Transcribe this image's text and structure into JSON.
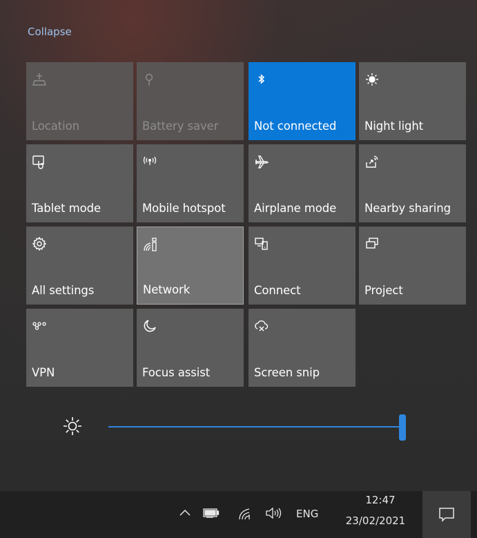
{
  "panel": {
    "collapse_label": "Collapse",
    "tiles": [
      {
        "label": "Location",
        "icon": "location-icon",
        "state": "disabled"
      },
      {
        "label": "Battery saver",
        "icon": "battery-saver-icon",
        "state": "disabled"
      },
      {
        "label": "Not connected",
        "icon": "bluetooth-icon",
        "state": "on"
      },
      {
        "label": "Night light",
        "icon": "night-light-icon",
        "state": "off"
      },
      {
        "label": "Tablet mode",
        "icon": "tablet-mode-icon",
        "state": "off"
      },
      {
        "label": "Mobile hotspot",
        "icon": "mobile-hotspot-icon",
        "state": "off"
      },
      {
        "label": "Airplane mode",
        "icon": "airplane-icon",
        "state": "off"
      },
      {
        "label": "Nearby sharing",
        "icon": "nearby-sharing-icon",
        "state": "off"
      },
      {
        "label": "All settings",
        "icon": "gear-icon",
        "state": "off"
      },
      {
        "label": "Network",
        "icon": "network-icon",
        "state": "selected"
      },
      {
        "label": "Connect",
        "icon": "connect-icon",
        "state": "off"
      },
      {
        "label": "Project",
        "icon": "project-icon",
        "state": "off"
      },
      {
        "label": "VPN",
        "icon": "vpn-icon",
        "state": "off"
      },
      {
        "label": "Focus assist",
        "icon": "moon-icon",
        "state": "off"
      },
      {
        "label": "Screen snip",
        "icon": "screen-snip-icon",
        "state": "off"
      }
    ]
  },
  "brightness": {
    "icon": "brightness-sun-icon",
    "level_percent": 100
  },
  "taskbar": {
    "tray_icons": [
      "chevron-up-icon",
      "battery-icon",
      "wifi-icon",
      "speaker-icon"
    ],
    "language": "ENG",
    "time": "12:47",
    "date": "23/02/2021",
    "action_center_icon": "notification-icon"
  },
  "colors": {
    "accent": "#0a78d7",
    "tile": "#5c5c5c",
    "link": "#9fc3ee",
    "taskbar": "#202020"
  }
}
